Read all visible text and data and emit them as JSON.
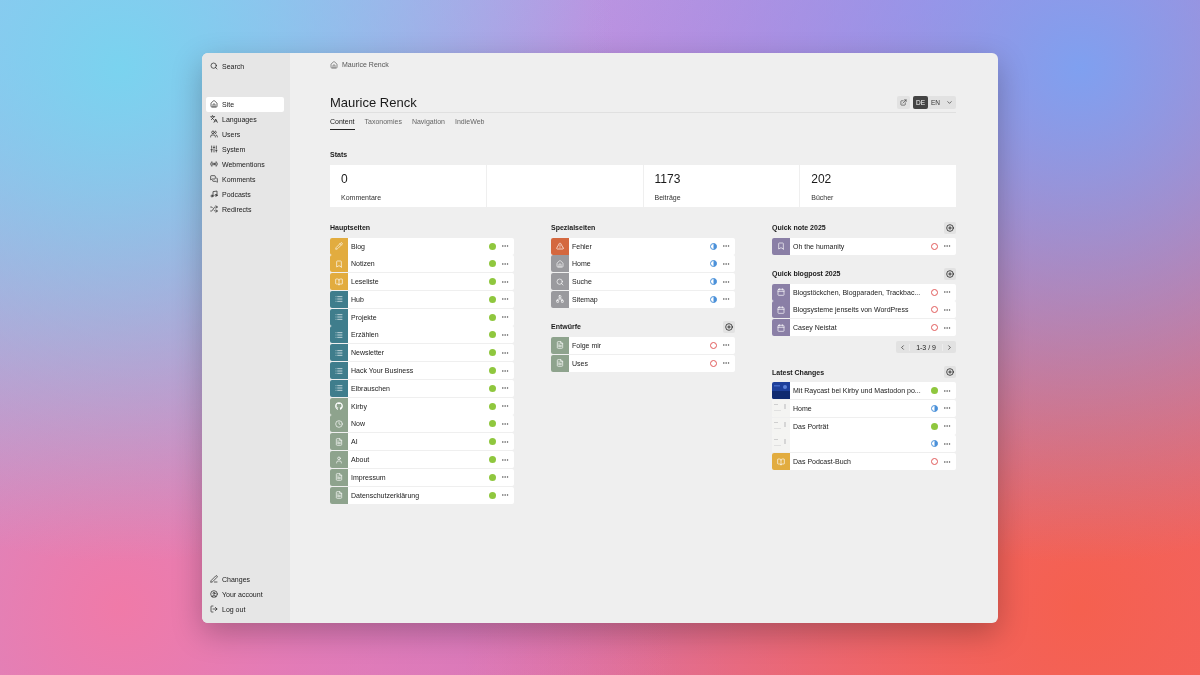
{
  "sidebar": {
    "search": {
      "label": "Search"
    },
    "items": [
      {
        "label": "Site",
        "kind": "home",
        "selected": true
      },
      {
        "label": "Languages",
        "kind": "languages",
        "selected": false
      },
      {
        "label": "Users",
        "kind": "users",
        "selected": false
      },
      {
        "label": "System",
        "kind": "sliders",
        "selected": false
      },
      {
        "label": "Webmentions",
        "kind": "radio",
        "selected": false
      },
      {
        "label": "Komments",
        "kind": "messages",
        "selected": false
      },
      {
        "label": "Podcasts",
        "kind": "music",
        "selected": false
      },
      {
        "label": "Redirects",
        "kind": "shuffle",
        "selected": false
      }
    ],
    "footer": [
      {
        "label": "Changes",
        "kind": "pen"
      },
      {
        "label": "Your account",
        "kind": "account"
      },
      {
        "label": "Log out",
        "kind": "logout"
      }
    ]
  },
  "breadcrumb": "Maurice Renck",
  "title": "Maurice Renck",
  "languages": [
    {
      "label": "DE",
      "selected": true
    },
    {
      "label": "EN",
      "selected": false
    }
  ],
  "tabs": [
    {
      "label": "Content",
      "selected": true
    },
    {
      "label": "Taxonomies",
      "selected": false
    },
    {
      "label": "Navigation",
      "selected": false
    },
    {
      "label": "IndieWeb",
      "selected": false
    }
  ],
  "stats": {
    "title": "Stats",
    "cards": [
      {
        "kind": "stat",
        "value": "0",
        "label": "Kommentare"
      },
      {
        "kind": "empty"
      },
      {
        "kind": "stat",
        "value": "1173",
        "label": "Beiträge"
      },
      {
        "kind": "stat",
        "value": "202",
        "label": "Bücher"
      }
    ]
  },
  "columns": [
    [
      {
        "title": "Hauptseiten",
        "items": [
          {
            "title": "Blog",
            "kind": "pen",
            "color": "#e2ac3f",
            "published": true,
            "listed": true
          },
          {
            "title": "Notizen",
            "kind": "bookmark",
            "color": "#e2ac3f",
            "published": true,
            "listed": true
          },
          {
            "title": "Leseliste",
            "kind": "book",
            "color": "#e2ac3f",
            "published": true,
            "listed": true
          },
          {
            "title": "Hub",
            "kind": "list",
            "color": "#3f7d8c",
            "published": true,
            "listed": true
          },
          {
            "title": "Projekte",
            "kind": "list",
            "color": "#3f7d8c",
            "published": true,
            "listed": true
          },
          {
            "title": "Erzählen",
            "kind": "list",
            "color": "#3f7d8c",
            "published": true,
            "listed": true
          },
          {
            "title": "Newsletter",
            "kind": "list",
            "color": "#3f7d8c",
            "published": true,
            "listed": true
          },
          {
            "title": "Hack Your Business",
            "kind": "list",
            "color": "#3f7d8c",
            "published": true,
            "listed": true
          },
          {
            "title": "Elbrauschen",
            "kind": "list",
            "color": "#3f7d8c",
            "published": true,
            "listed": true
          },
          {
            "title": "Kirby",
            "kind": "github",
            "color": "#8ea38d",
            "published": true,
            "listed": true
          },
          {
            "title": "Now",
            "kind": "clock",
            "color": "#8ea38d",
            "published": true,
            "listed": true
          },
          {
            "title": "AI",
            "kind": "page",
            "color": "#8ea38d",
            "published": true,
            "listed": true
          },
          {
            "title": "About",
            "kind": "user",
            "color": "#8ea38d",
            "published": true,
            "listed": true
          },
          {
            "title": "Impressum",
            "kind": "page",
            "color": "#8ea38d",
            "published": true,
            "listed": true
          },
          {
            "title": "Datenschutzerklärung",
            "kind": "page",
            "color": "#8ea38d",
            "published": true,
            "listed": true
          }
        ]
      }
    ],
    [
      {
        "title": "Spezialseiten",
        "items": [
          {
            "title": "Fehler",
            "kind": "alert",
            "color": "#d4683f",
            "published": true,
            "listed": false
          },
          {
            "title": "Home",
            "kind": "home",
            "color": "#9a9a9e",
            "published": true,
            "listed": false
          },
          {
            "title": "Suche",
            "kind": "search",
            "color": "#9a9a9e",
            "published": true,
            "listed": false
          },
          {
            "title": "Sitemap",
            "kind": "sitemap",
            "color": "#9a9a9e",
            "published": true,
            "listed": false
          }
        ]
      },
      {
        "title": "Entwürfe",
        "add_button": true,
        "items": [
          {
            "title": "Folge mir",
            "kind": "page",
            "color": "#8ea38d",
            "published": false
          },
          {
            "title": "Uses",
            "kind": "page",
            "color": "#8ea38d",
            "published": false
          }
        ]
      }
    ],
    [
      {
        "title": "Quick note 2025",
        "add_button": true,
        "items": [
          {
            "title": "Oh the humanity",
            "kind": "bookmark",
            "color": "#8a7fa6",
            "published": false
          }
        ]
      },
      {
        "title": "Quick blogpost 2025",
        "add_button": true,
        "items": [
          {
            "title": "Blogstöckchen, Blogparaden, Trackbac...",
            "kind": "calendar",
            "color": "#8a7fa6",
            "published": false
          },
          {
            "title": "Blogsysteme jenseits von WordPress",
            "kind": "calendar",
            "color": "#8a7fa6",
            "published": false
          },
          {
            "title": "Casey Neistat",
            "kind": "calendar",
            "color": "#8a7fa6",
            "published": false
          }
        ],
        "pagination": "1-3 / 9"
      },
      {
        "title": "Latest Changes",
        "add_button": true,
        "items": [
          {
            "title": "Mit Raycast bei Kirby und Mastodon po...",
            "kind": "picture",
            "published": true,
            "listed": true
          },
          {
            "title": "Home",
            "kind": "picture",
            "published": true,
            "listed": false
          },
          {
            "title": "Das Porträt",
            "kind": "picture",
            "published": true,
            "listed": true
          },
          {
            "kind": "picture",
            "published": true,
            "listed": false
          },
          {
            "title": "Das Podcast-Buch",
            "kind": "book",
            "color": "#e2ac3f",
            "published": false
          }
        ]
      }
    ]
  ]
}
